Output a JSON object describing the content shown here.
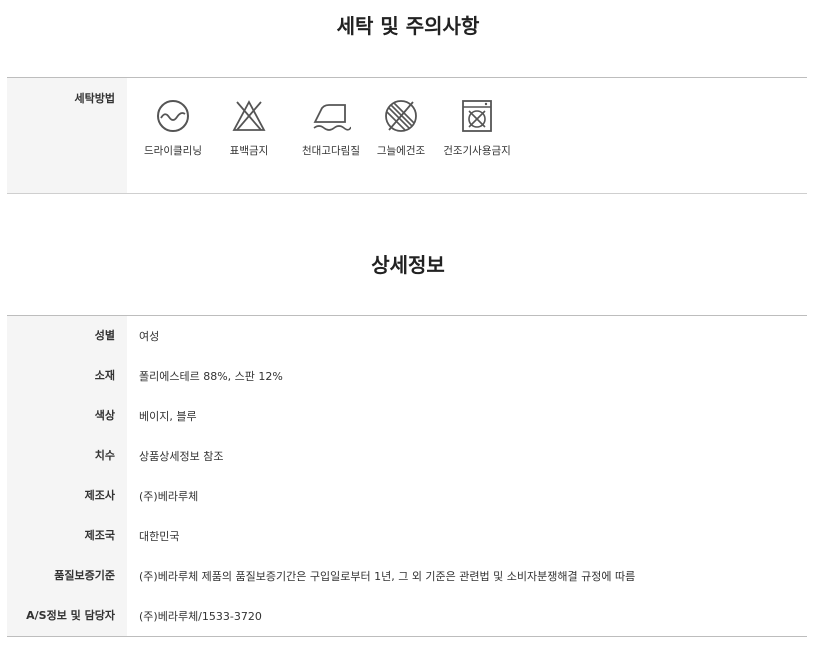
{
  "washing": {
    "title": "세탁 및 주의사항",
    "row_label": "세탁방법",
    "items": [
      {
        "icon": "dry-cleaning-icon",
        "label": "드라이클리닝"
      },
      {
        "icon": "no-bleach-icon",
        "label": "표백금지"
      },
      {
        "icon": "low-iron-icon",
        "label": "천대고다림질"
      },
      {
        "icon": "shade-dry-icon",
        "label": "그늘에건조"
      },
      {
        "icon": "no-tumble-dry-icon",
        "label": "건조기사용금지"
      }
    ]
  },
  "details": {
    "title": "상세정보",
    "rows": [
      {
        "key": "성별",
        "value": "여성"
      },
      {
        "key": "소재",
        "value": "폴리에스테르 88%, 스판 12%"
      },
      {
        "key": "색상",
        "value": "베이지, 블루"
      },
      {
        "key": "치수",
        "value": "상품상세정보 참조"
      },
      {
        "key": "제조사",
        "value": "(주)베라루체"
      },
      {
        "key": "제조국",
        "value": "대한민국"
      },
      {
        "key": "품질보증기준",
        "value": "(주)베라루체 제품의 품질보증기간은 구입일로부터 1년, 그 외 기준은 관련법 및 소비자분쟁해결 규정에 따름"
      },
      {
        "key": "A/S정보 및 담당자",
        "value": "(주)베라루체/1533-3720"
      }
    ]
  },
  "colors": {
    "icon": "#555555",
    "label_bg": "#f5f5f5",
    "border": "#bdbdbd"
  }
}
